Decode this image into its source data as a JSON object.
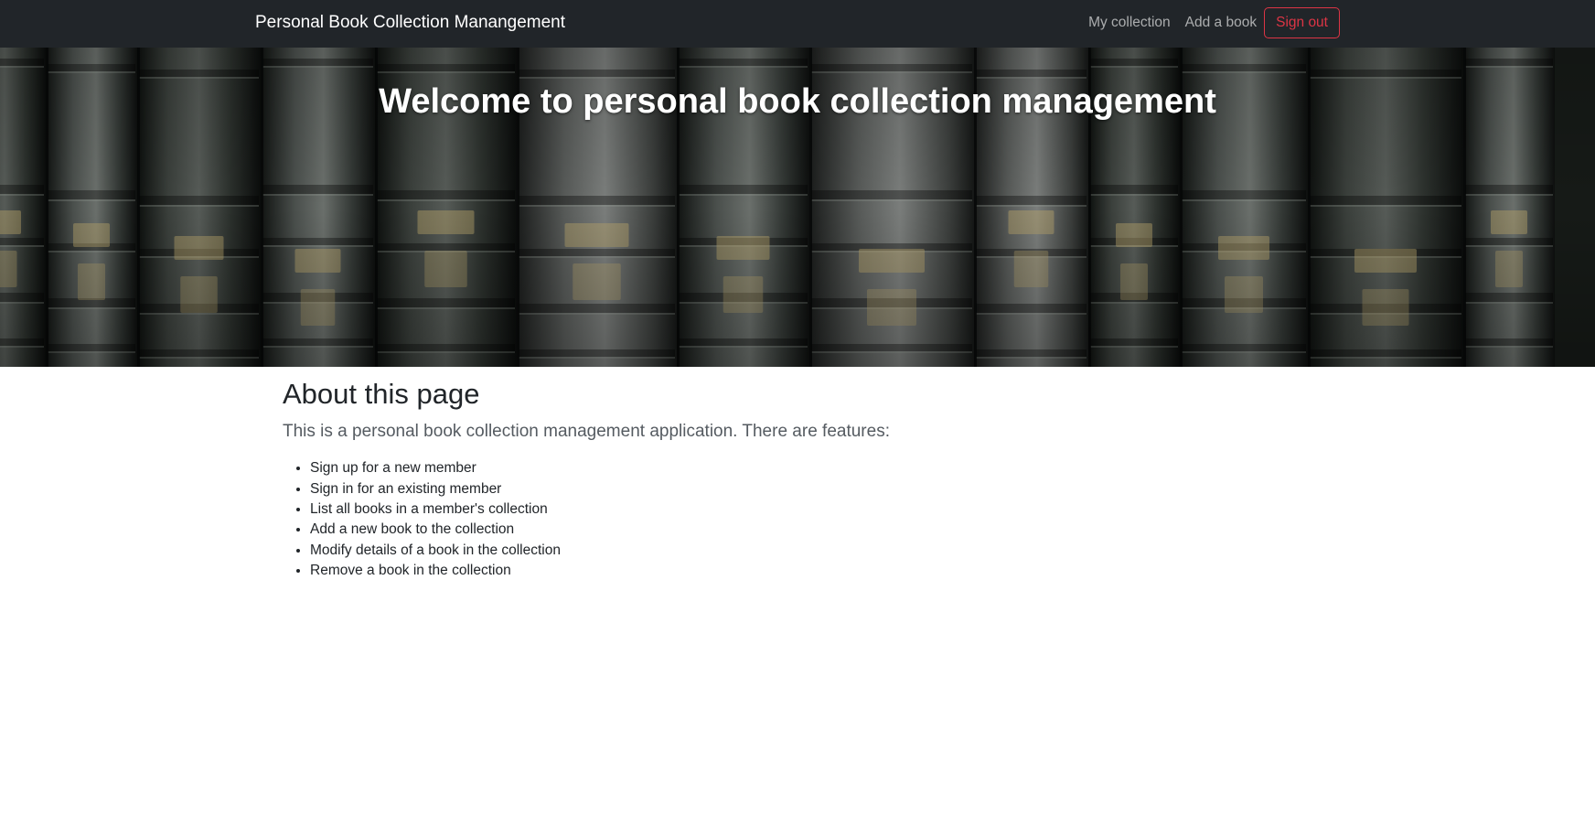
{
  "navbar": {
    "brand": "Personal Book Collection Manangement",
    "links": [
      {
        "label": "My collection"
      },
      {
        "label": "Add a book"
      }
    ],
    "sign_out_label": "Sign out"
  },
  "hero": {
    "title": "Welcome to personal book collection management"
  },
  "about": {
    "title": "About this page",
    "lead": "This is a personal book collection management application. There are features:",
    "features": [
      "Sign up for a new member",
      "Sign in for an existing member",
      "List all books in a member's collection",
      "Add a new book to the collection",
      "Modify details of a book in the collection",
      "Remove a book in the collection"
    ]
  },
  "colors": {
    "navbar_bg": "#212529",
    "danger": "#dc3545",
    "text": "#212529"
  }
}
